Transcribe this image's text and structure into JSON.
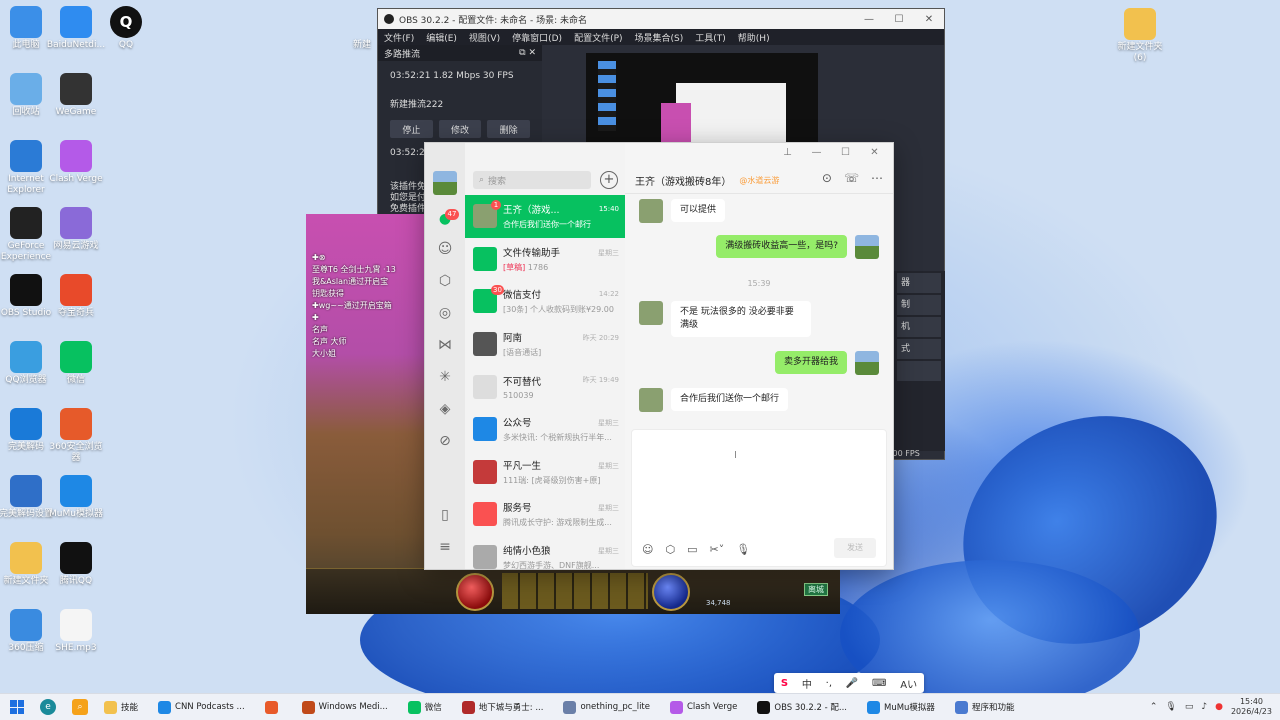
{
  "desktop": {
    "left_icons": [
      {
        "label": "此电脑",
        "color": "#3b8fe8",
        "icon": "computer-icon"
      },
      {
        "label": "回收站",
        "color": "#6aaee8",
        "icon": "recycle-bin-icon"
      },
      {
        "label": "Internet Explorer",
        "color": "#2b7bd6",
        "icon": "ie-icon"
      },
      {
        "label": "GeForce Experience",
        "color": "#222222",
        "icon": "geforce-icon"
      },
      {
        "label": "OBS Studio",
        "color": "#111111",
        "icon": "obs-icon"
      },
      {
        "label": "QQ浏览器",
        "color": "#3a9ee0",
        "icon": "qq-browser-icon"
      },
      {
        "label": "完美解码",
        "color": "#1a7ad8",
        "icon": "player-icon"
      },
      {
        "label": "完美解码设置",
        "color": "#2f6fc8",
        "icon": "settings-icon"
      },
      {
        "label": "新建文件夹",
        "color": "#f2c14e",
        "icon": "folder-icon"
      },
      {
        "label": "360压缩",
        "color": "#3a8be0",
        "icon": "zip-icon"
      }
    ],
    "col2_icons": [
      {
        "label": "BaiduNetdi...",
        "color": "#2f8cf0",
        "icon": "baidu-netdisk-icon"
      },
      {
        "label": "WeGame",
        "color": "#333333",
        "icon": "wegame-icon"
      },
      {
        "label": "Clash Verge",
        "color": "#b45ae8",
        "icon": "clash-icon"
      },
      {
        "label": "网易云游戏",
        "color": "#8a6ad8",
        "icon": "cloud-game-icon"
      },
      {
        "label": "夺宝奇兵",
        "color": "#e84a2a",
        "icon": "game-icon"
      },
      {
        "label": "微信",
        "color": "#07c160",
        "icon": "wechat-icon"
      },
      {
        "label": "360安全浏览器",
        "color": "#e65a2a",
        "icon": "360-browser-icon"
      },
      {
        "label": "MuMu模拟器",
        "color": "#1e88e5",
        "icon": "mumu-icon"
      },
      {
        "label": "腾讯QQ",
        "color": "#111111",
        "icon": "qq-icon"
      },
      {
        "label": "SHE.mp3",
        "color": "#f5f5f5",
        "icon": "mp3-icon"
      }
    ],
    "top_icons": [
      {
        "label": "QQ",
        "color": "#111111",
        "icon": "qq-icon"
      },
      {
        "label": "新建文件夹 (6)",
        "color": "#f2c14e",
        "icon": "folder-icon"
      }
    ],
    "partial_label": "新建"
  },
  "obs": {
    "title": "OBS 30.2.2 - 配置文件: 未命名 - 场景: 未命名",
    "menu": [
      "文件(F)",
      "编辑(E)",
      "视图(V)",
      "停靠窗口(D)",
      "配置文件(P)",
      "场景集合(S)",
      "工具(T)",
      "帮助(H)"
    ],
    "dock_title": "多路推流",
    "stat_line": "03:52:21  1.82 Mbps  30 FPS",
    "stream_name": "新建推流222",
    "buttons": [
      "停止",
      "修改",
      "删除"
    ],
    "time2": "03:52:23",
    "note_lines": [
      "该插件免",
      "如您是付",
      "免费插件"
    ],
    "right_buttons": [
      "器",
      "制",
      "机",
      "式"
    ],
    "fps": ".00 FPS"
  },
  "game": {
    "chat_lines": [
      "✚⊗",
      "至尊T6 全剑士九霄 ·13",
      "我&Aslan通过开启宝",
      "钥匙获得",
      "✚wg~~通过开启宝箱",
      "✚",
      "名声",
      "名声 大师",
      "大小姐"
    ],
    "gold": "34,748",
    "exit_label": "离城"
  },
  "wechat": {
    "search_placeholder": "搜索",
    "nav_badge": "47",
    "chats": [
      {
        "name": "王齐（游戏...",
        "preview": "合作后我们送你一个邮行",
        "time": "15:40",
        "badge": "1",
        "active": true,
        "color": "#8aa070"
      },
      {
        "name": "文件传输助手",
        "tag": "[草稿]",
        "preview": " 1786",
        "time": "星期三",
        "color": "#07c160"
      },
      {
        "name": "微信支付",
        "preview": "[30条] 个人收款码到账¥29.00",
        "time": "14:22",
        "badge": "30",
        "color": "#07c160"
      },
      {
        "name": "阿南",
        "preview": "[语音通话]",
        "time": "昨天 20:29",
        "color": "#555555"
      },
      {
        "name": "不可替代",
        "preview": "510039",
        "time": "昨天 19:49",
        "color": "#dddddd"
      },
      {
        "name": "公众号",
        "preview": "多米快讯: 个税新规执行半年...",
        "time": "星期三",
        "color": "#1e88e5"
      },
      {
        "name": "平凡一生",
        "preview": "111瑞: [虎哥级别伤害+原]",
        "time": "星期三",
        "color": "#c43a3a"
      },
      {
        "name": "服务号",
        "preview": "腾讯成长守护: 游戏限制生成...",
        "time": "星期三",
        "color": "#fa5151"
      },
      {
        "name": "纯情小色狼",
        "preview": "梦幻西游手游、DNF旗舰...",
        "time": "星期三",
        "color": "#aaaaaa"
      }
    ],
    "header_name": "王齐（游戏搬砖8年）",
    "header_sub": "@水道云游",
    "messages": [
      {
        "side": "left",
        "text": "可以提供"
      },
      {
        "side": "right",
        "text": "满级搬砖收益高一些，是吗?"
      },
      {
        "side": "left",
        "text": "不是 玩法很多的 没必要非要满级"
      },
      {
        "side": "right",
        "text": "卖多开器给我"
      },
      {
        "side": "left",
        "text": "合作后我们送你一个邮行"
      }
    ],
    "timestamp": "15:39",
    "send_label": "发送"
  },
  "ime": [
    "中",
    "·,",
    "🎤",
    "⌨",
    "Aい"
  ],
  "taskbar": {
    "apps": [
      {
        "label": "技能",
        "color": "#f2c14e"
      },
      {
        "label": "CNN Podcasts ...",
        "color": "#1e88e5"
      },
      {
        "label": "",
        "color": "#e85a2a"
      },
      {
        "label": "Windows Medi...",
        "color": "#c04a1a"
      },
      {
        "label": "微信",
        "color": "#07c160"
      },
      {
        "label": "地下城与勇士: ...",
        "color": "#b02a2a"
      },
      {
        "label": "onething_pc_lite",
        "color": "#6a7fa8"
      },
      {
        "label": "Clash Verge",
        "color": "#b45ae8"
      },
      {
        "label": "OBS 30.2.2 - 配...",
        "color": "#111111"
      },
      {
        "label": "MuMu模拟器",
        "color": "#1e88e5"
      },
      {
        "label": "程序和功能",
        "color": "#4a7ad0"
      }
    ],
    "time": "15:40",
    "date": "2026/4/23"
  }
}
